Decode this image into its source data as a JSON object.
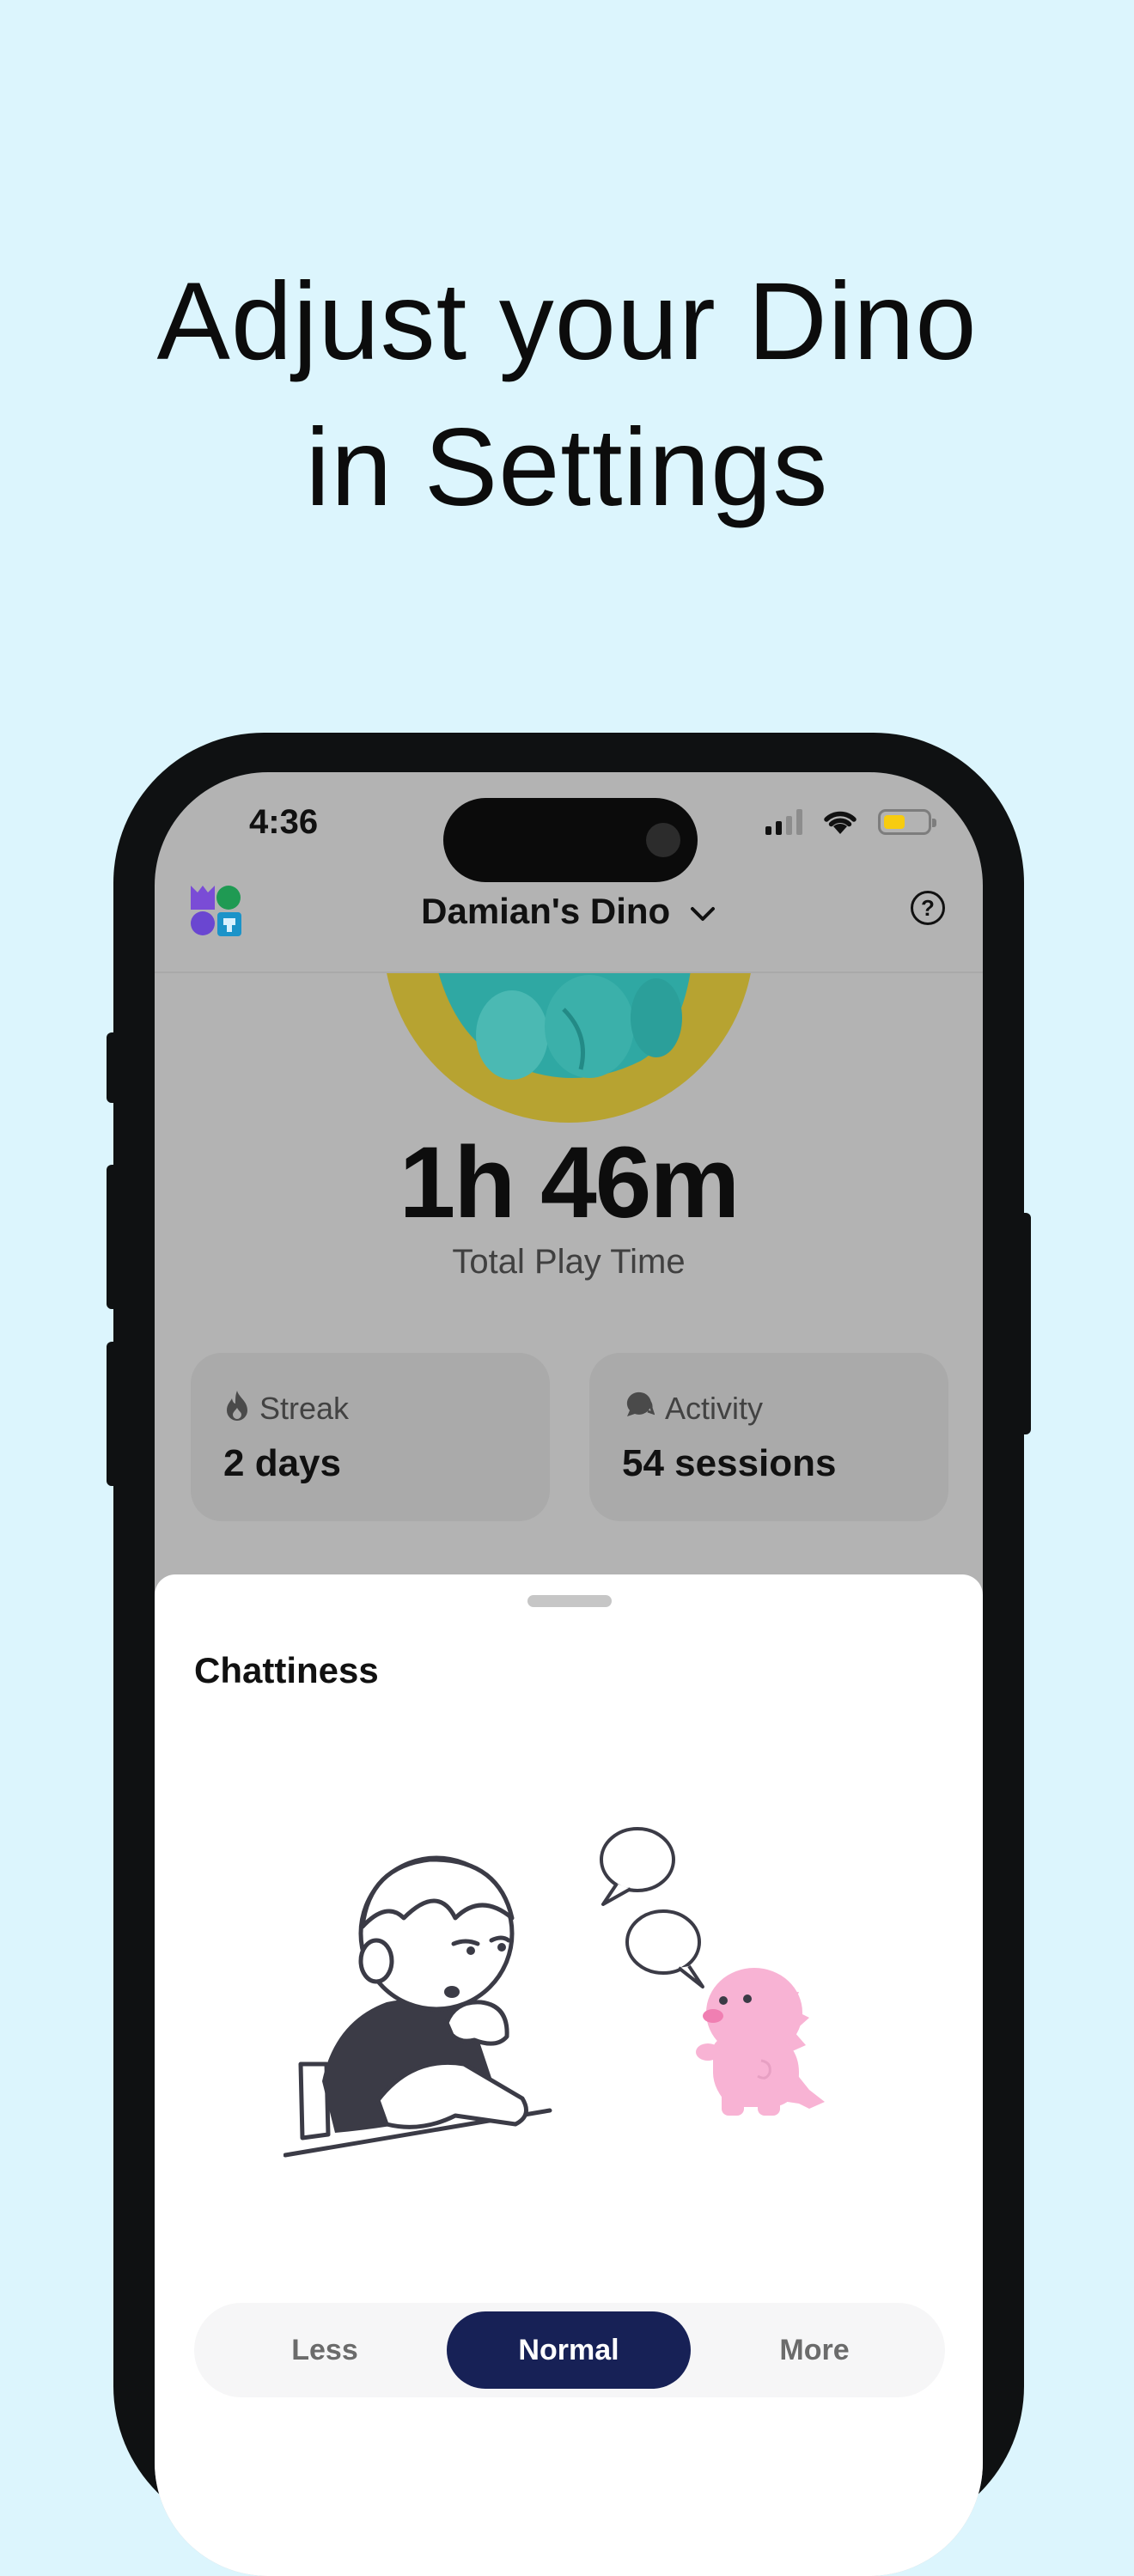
{
  "headline": {
    "line1": "Adjust your Dino",
    "line2": "in Settings"
  },
  "status_bar": {
    "time": "4:36"
  },
  "header": {
    "title": "Damian's Dino",
    "help_icon": "question-circle-icon"
  },
  "summary": {
    "play_time": "1h 46m",
    "play_time_label": "Total Play Time"
  },
  "stats": [
    {
      "icon": "flame-icon",
      "label": "Streak",
      "value": "2 days"
    },
    {
      "icon": "chat-bubble-icon",
      "label": "Activity",
      "value": "54 sessions"
    }
  ],
  "sheet": {
    "title": "Chattiness",
    "options": [
      "Less",
      "Normal",
      "More"
    ],
    "selected": "Normal"
  },
  "colors": {
    "background": "#dcf5fd",
    "selected_option": "#172156",
    "dino_pink": "#f8b3d4",
    "avatar_yellow": "#b7a331",
    "avatar_teal": "#2fa8a3"
  }
}
